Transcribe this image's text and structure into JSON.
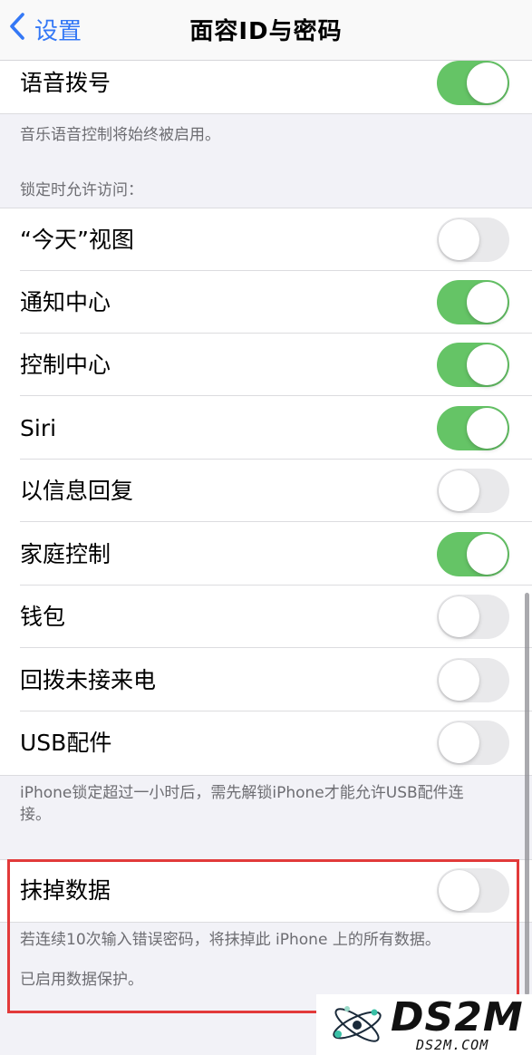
{
  "navbar": {
    "back_label": "设置",
    "title": "面容ID与密码"
  },
  "group_top": {
    "rows": [
      {
        "label": "语音拨号",
        "on": true
      }
    ],
    "footer": "音乐语音控制将始终被启用。"
  },
  "lock_access": {
    "header": "锁定时允许访问：",
    "rows": [
      {
        "label": "“今天”视图",
        "on": false
      },
      {
        "label": "通知中心",
        "on": true
      },
      {
        "label": "控制中心",
        "on": true
      },
      {
        "label": "Siri",
        "on": true
      },
      {
        "label": "以信息回复",
        "on": false
      },
      {
        "label": "家庭控制",
        "on": true
      },
      {
        "label": "钱包",
        "on": false
      },
      {
        "label": "回拨未接来电",
        "on": false
      },
      {
        "label": "USB配件",
        "on": false
      }
    ],
    "footer": "iPhone锁定超过一小时后，需先解锁iPhone才能允许USB配件连接。"
  },
  "erase": {
    "rows": [
      {
        "label": "抹掉数据",
        "on": false
      }
    ],
    "footer_line1": "若连续10次输入错误密码，将抹掉此 iPhone 上的所有数据。",
    "footer_line2": "已启用数据保护。"
  },
  "colors": {
    "toggle_on": "#65c466",
    "toggle_off": "#e9e9eb",
    "accent": "#3478f6",
    "highlight": "#e23a3a"
  },
  "watermark": {
    "brand": "DS2M",
    "url": "DS2M.COM"
  }
}
